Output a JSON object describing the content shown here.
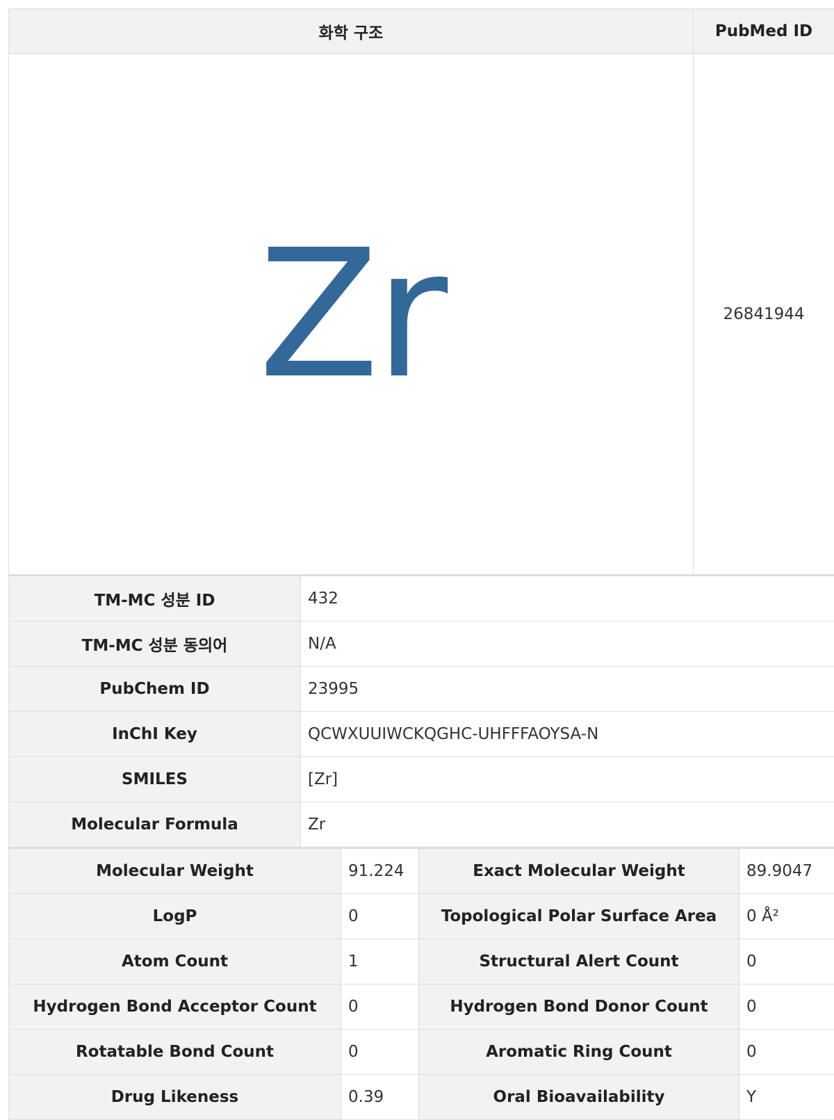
{
  "structure_table": {
    "header_structure": "화학 구조",
    "header_pubmed": "PubMed ID",
    "structure_text": "Zr",
    "pubmed_id": "26841944"
  },
  "id_rows": [
    {
      "label": "TM-MC 성분 ID",
      "value": "432"
    },
    {
      "label": "TM-MC 성분 동의어",
      "value": "N/A"
    },
    {
      "label": "PubChem ID",
      "value": "23995"
    },
    {
      "label": "InChI Key",
      "value": "QCWXUUIWCKQGHC-UHFFFAOYSA-N"
    },
    {
      "label": "SMILES",
      "value": "[Zr]"
    },
    {
      "label": "Molecular Formula",
      "value": "Zr"
    }
  ],
  "property_rows": [
    {
      "l1": "Molecular Weight",
      "v1": "91.224",
      "l2": "Exact Molecular Weight",
      "v2": "89.9047"
    },
    {
      "l1": "LogP",
      "v1": "0",
      "l2": "Topological Polar Surface Area",
      "v2": "0 Å²"
    },
    {
      "l1": "Atom Count",
      "v1": "1",
      "l2": "Structural Alert Count",
      "v2": "0"
    },
    {
      "l1": "Hydrogen Bond Acceptor Count",
      "v1": "0",
      "l2": "Hydrogen Bond Donor Count",
      "v2": "0"
    },
    {
      "l1": "Rotatable Bond Count",
      "v1": "0",
      "l2": "Aromatic Ring Count",
      "v2": "0"
    },
    {
      "l1": "Drug Likeness",
      "v1": "0.39",
      "l2": "Oral Bioavailability",
      "v2": "Y"
    }
  ]
}
